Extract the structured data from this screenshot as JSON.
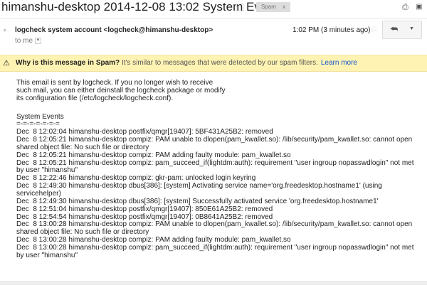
{
  "header": {
    "subject": "himanshu-desktop 2014-12-08 13:02 System Events",
    "label": "Spam",
    "label_remove": "x",
    "print_icon": "printer-icon",
    "newwindow_icon": "new-window-icon"
  },
  "message": {
    "sender": "logcheck system account <logcheck@himanshu-desktop>",
    "to": "to me",
    "time": "1:02 PM (3 minutes ago)",
    "reply_icon": "reply-icon",
    "more_icon": "chevron-down-icon"
  },
  "spam_banner": {
    "question": "Why is this message in Spam?",
    "explanation": "It's similar to messages that were detected by our spam filters.",
    "learn_more": "Learn more"
  },
  "body": {
    "intro": [
      "This email is sent by logcheck. If you no longer wish to receive",
      "such mail, you can either deinstall the logcheck package or modify",
      "its configuration file (/etc/logcheck/logcheck.conf)."
    ],
    "section_title": "System Events",
    "section_rule": "=-=-=-=-=-=-=",
    "log": [
      "Dec  8 12:02:04 himanshu-desktop postfix/qmgr[19407]: 5BF431A25B2: removed",
      "Dec  8 12:05:21 himanshu-desktop compiz: PAM unable to dlopen(pam_kwallet.so): /lib/security/pam_kwallet.so: cannot open shared object file: No such file or directory",
      "Dec  8 12:05:21 himanshu-desktop compiz: PAM adding faulty module: pam_kwallet.so",
      "Dec  8 12:05:21 himanshu-desktop compiz: pam_succeed_if(lightdm:auth): requirement \"user ingroup nopasswdlogin\" not met by user \"himanshu\"",
      "Dec  8 12:22:46 himanshu-desktop compiz: gkr-pam: unlocked login keyring",
      "Dec  8 12:49:30 himanshu-desktop dbus[386]: [system] Activating service name='org.freedesktop.hostname1' (using servicehelper)",
      "Dec  8 12:49:30 himanshu-desktop dbus[386]: [system] Successfully activated service 'org.freedesktop.hostname1'",
      "Dec  8 12:51:04 himanshu-desktop postfix/qmgr[19407]: 850E61A25B2: removed",
      "Dec  8 12:54:54 himanshu-desktop postfix/qmgr[19407]: 0B8641A25B2: removed",
      "Dec  8 13:00:28 himanshu-desktop compiz: PAM unable to dlopen(pam_kwallet.so): /lib/security/pam_kwallet.so: cannot open shared object file: No such file or directory",
      "Dec  8 13:00:28 himanshu-desktop compiz: PAM adding faulty module: pam_kwallet.so",
      "Dec  8 13:00:28 himanshu-desktop compiz: pam_succeed_if(lightdm:auth): requirement \"user ingroup nopasswdlogin\" not met by user \"himanshu\""
    ]
  }
}
